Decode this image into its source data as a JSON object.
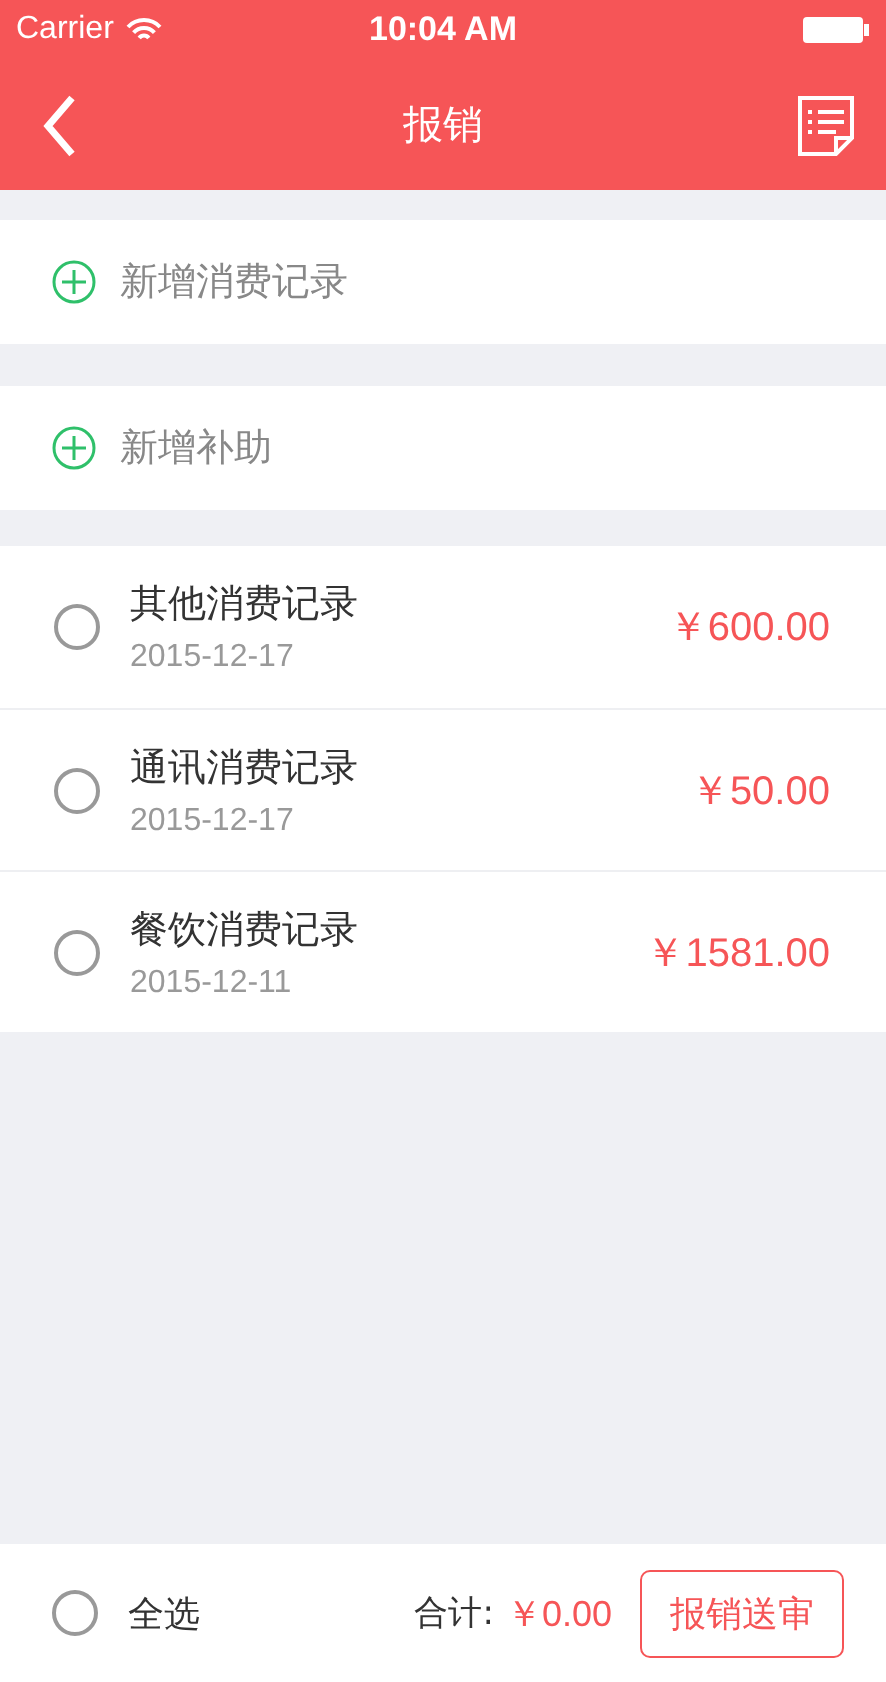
{
  "status_bar": {
    "carrier": "Carrier",
    "time": "10:04 AM"
  },
  "nav": {
    "title": "报销"
  },
  "add_actions": [
    {
      "label": "新增消费记录"
    },
    {
      "label": "新增补助"
    }
  ],
  "records": [
    {
      "name": "其他消费记录",
      "date": "2015-12-17",
      "amount": "￥600.00",
      "selected": false
    },
    {
      "name": "通讯消费记录",
      "date": "2015-12-17",
      "amount": "￥50.00",
      "selected": false
    },
    {
      "name": "餐饮消费记录",
      "date": "2015-12-11",
      "amount": "￥1581.00",
      "selected": false
    }
  ],
  "footer": {
    "select_all": {
      "label": "全选",
      "checked": false
    },
    "total_label": "合计:",
    "total": "￥0.00",
    "submit": "报销送审"
  }
}
